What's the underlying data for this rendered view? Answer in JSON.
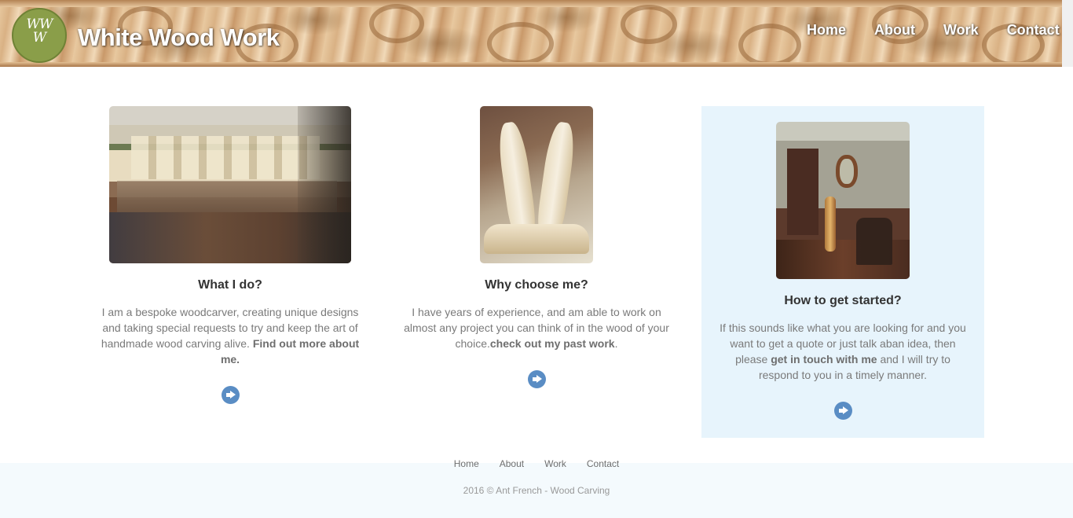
{
  "header": {
    "logo_text": "WWW",
    "brand": "White Wood Work",
    "nav": [
      "Home",
      "About",
      "Work",
      "Contact"
    ]
  },
  "columns": [
    {
      "title": "What I do?",
      "text_before": "I am a bespoke woodcarver, creating unique designs and taking special requests to try and keep the art of handmade wood carving alive. ",
      "link": "Find out more about me.",
      "text_after": ""
    },
    {
      "title": "Why choose me?",
      "text_before": "I have years of experience, and am able to work on almost any project you can think of in the wood of your choice.",
      "link": "check out my past work",
      "text_after": "."
    },
    {
      "title": "How to get started?",
      "text_before": "If this sounds like what you are looking for and you want to get a quote or just talk aban idea, then please ",
      "link": "get in touch with me",
      "text_after": " and I will try to respond to you in a timely manner."
    }
  ],
  "footer": {
    "links": [
      "Home",
      "About",
      "Work",
      "Contact"
    ],
    "copyright": "2016 © Ant French - Wood Carving"
  },
  "colors": {
    "accent": "#5a8dc4",
    "logo_green": "#8a9e49",
    "highlight_panel": "#e7f4fc"
  }
}
